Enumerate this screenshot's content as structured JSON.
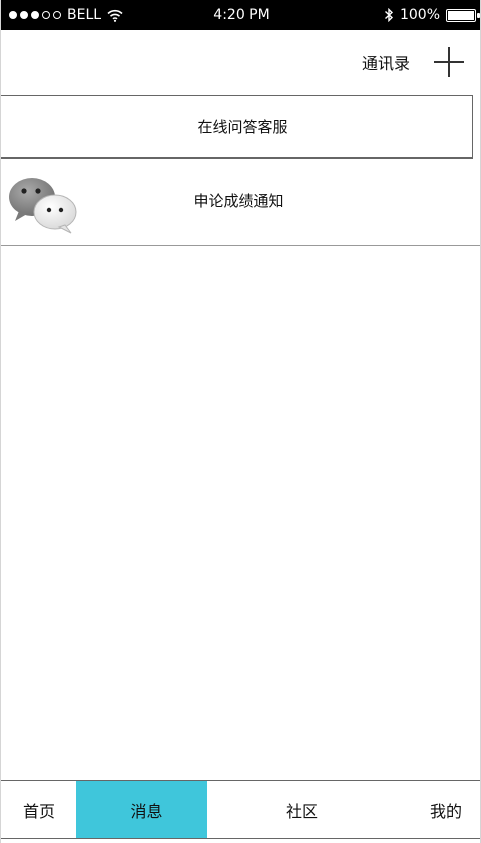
{
  "status_bar": {
    "carrier": "BELL",
    "time": "4:20 PM",
    "battery": "100%",
    "battery_level": 1.0,
    "signal_bars_filled": 3,
    "signal_bars_total": 5,
    "icons": [
      "wifi-icon",
      "bluetooth-icon",
      "battery-icon"
    ]
  },
  "top_nav": {
    "contacts_label": "通讯录",
    "add_icon": "plus-icon"
  },
  "messages": [
    {
      "title": "在线问答客服"
    },
    {
      "title": "申论成绩通知",
      "icon": "chat-bubbles-icon"
    }
  ],
  "tab_bar": {
    "tabs": [
      {
        "label": "首页"
      },
      {
        "label": "消息",
        "active": true
      },
      {
        "label": "社区"
      },
      {
        "label": "我的"
      }
    ],
    "active_color": "#3fc6db"
  }
}
